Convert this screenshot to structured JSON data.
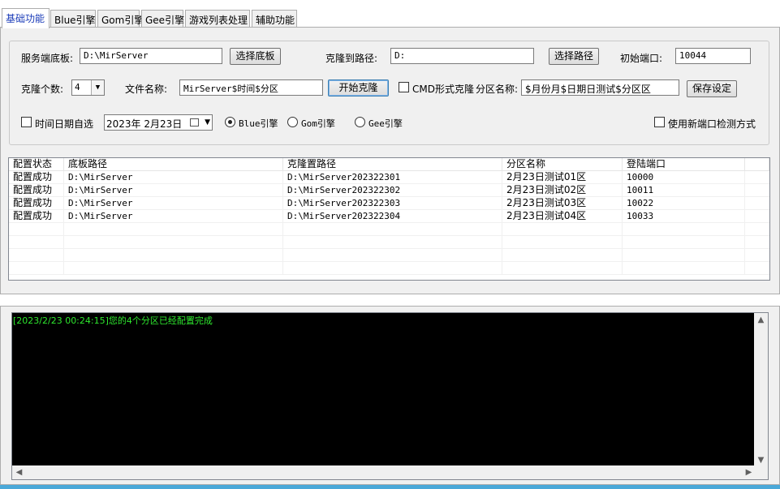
{
  "tabs": [
    "基础功能",
    "Blue引擎",
    "Gom引擎",
    "Gee引擎",
    "游戏列表处理",
    "辅助功能"
  ],
  "form": {
    "server_template_label": "服务端底板:",
    "server_template_value": "D:\\MirServer",
    "select_template_button": "选择底板",
    "clone_path_label": "克隆到路径:",
    "clone_path_value": "D:",
    "select_path_button": "选择路径",
    "start_port_label": "初始端口:",
    "start_port_value": "10044",
    "clone_count_label": "克隆个数:",
    "clone_count_value": "4",
    "file_name_label": "文件名称:",
    "file_name_value": "MirServer$时间$分区",
    "start_clone_button": "开始克隆",
    "cmd_clone_label": "CMD形式克隆",
    "zone_name_label": "分区名称:",
    "zone_name_value": "$月份月$日期日测试$分区区",
    "save_settings_button": "保存设定",
    "custom_date_label": "时间日期自选",
    "date_value": "2023年  2月23日",
    "engine_blue_label": "Blue引擎",
    "engine_gom_label": "Gom引擎",
    "engine_gee_label": "Gee引擎",
    "new_port_detect_label": "使用新端口检测方式"
  },
  "table": {
    "columns": [
      "配置状态",
      "底板路径",
      "克隆置路径",
      "分区名称",
      "登陆端口"
    ],
    "rows": [
      [
        "配置成功",
        "D:\\MirServer",
        "D:\\MirServer202322301",
        "2月23日测试01区",
        "10000"
      ],
      [
        "配置成功",
        "D:\\MirServer",
        "D:\\MirServer202322302",
        "2月23日测试02区",
        "10011"
      ],
      [
        "配置成功",
        "D:\\MirServer",
        "D:\\MirServer202322303",
        "2月23日测试03区",
        "10022"
      ],
      [
        "配置成功",
        "D:\\MirServer",
        "D:\\MirServer202322304",
        "2月23日测试04区",
        "10033"
      ]
    ]
  },
  "log": {
    "lines": [
      "[2023/2/23 00:24:15]您的4个分区已经配置完成"
    ]
  },
  "colors": {
    "active_tab_text": "#1a3bb8",
    "log_text": "#2ee82e",
    "log_background": "#000000",
    "window_background": "#f0f0f0"
  },
  "icons": {
    "dropdown": "chevron-down-icon",
    "calendar": "calendar-icon",
    "scroll_up": "arrow-up-icon",
    "scroll_down": "arrow-down-icon",
    "scroll_left": "arrow-left-icon",
    "scroll_right": "arrow-right-icon"
  }
}
